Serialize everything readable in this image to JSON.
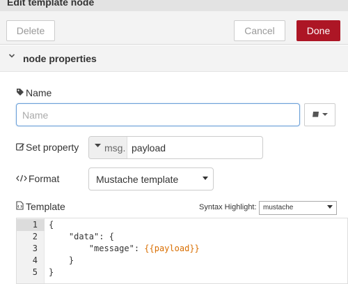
{
  "dialog": {
    "title": "Edit template node"
  },
  "toolbar": {
    "delete_label": "Delete",
    "cancel_label": "Cancel",
    "done_label": "Done"
  },
  "section": {
    "title": "node properties",
    "icon": "chevron-down-icon"
  },
  "fields": {
    "name": {
      "label": "Name",
      "icon": "tag-icon",
      "placeholder": "Name",
      "value": ""
    },
    "property": {
      "label": "Set property",
      "icon": "edit-icon",
      "prefix": "msg.",
      "value": "payload"
    },
    "format": {
      "label": "Format",
      "icon": "code-icon",
      "value": "Mustache template"
    },
    "template": {
      "label": "Template",
      "icon": "file-code-icon"
    },
    "syntax_highlight": {
      "label": "Syntax Highlight:",
      "value": "mustache"
    }
  },
  "editor": {
    "line_numbers": [
      "1",
      "2",
      "3",
      "4",
      "5"
    ],
    "lines": [
      {
        "a": "{"
      },
      {
        "a": "    \"data\": {"
      },
      {
        "a": "        \"message\": ",
        "b": "{{",
        "c": "payload",
        "d": "}}"
      },
      {
        "a": "    }"
      },
      {
        "a": "}"
      }
    ]
  },
  "colors": {
    "accent": "#ad1625",
    "focus_border": "#6a9fd8",
    "template_var": "#d96e00"
  }
}
